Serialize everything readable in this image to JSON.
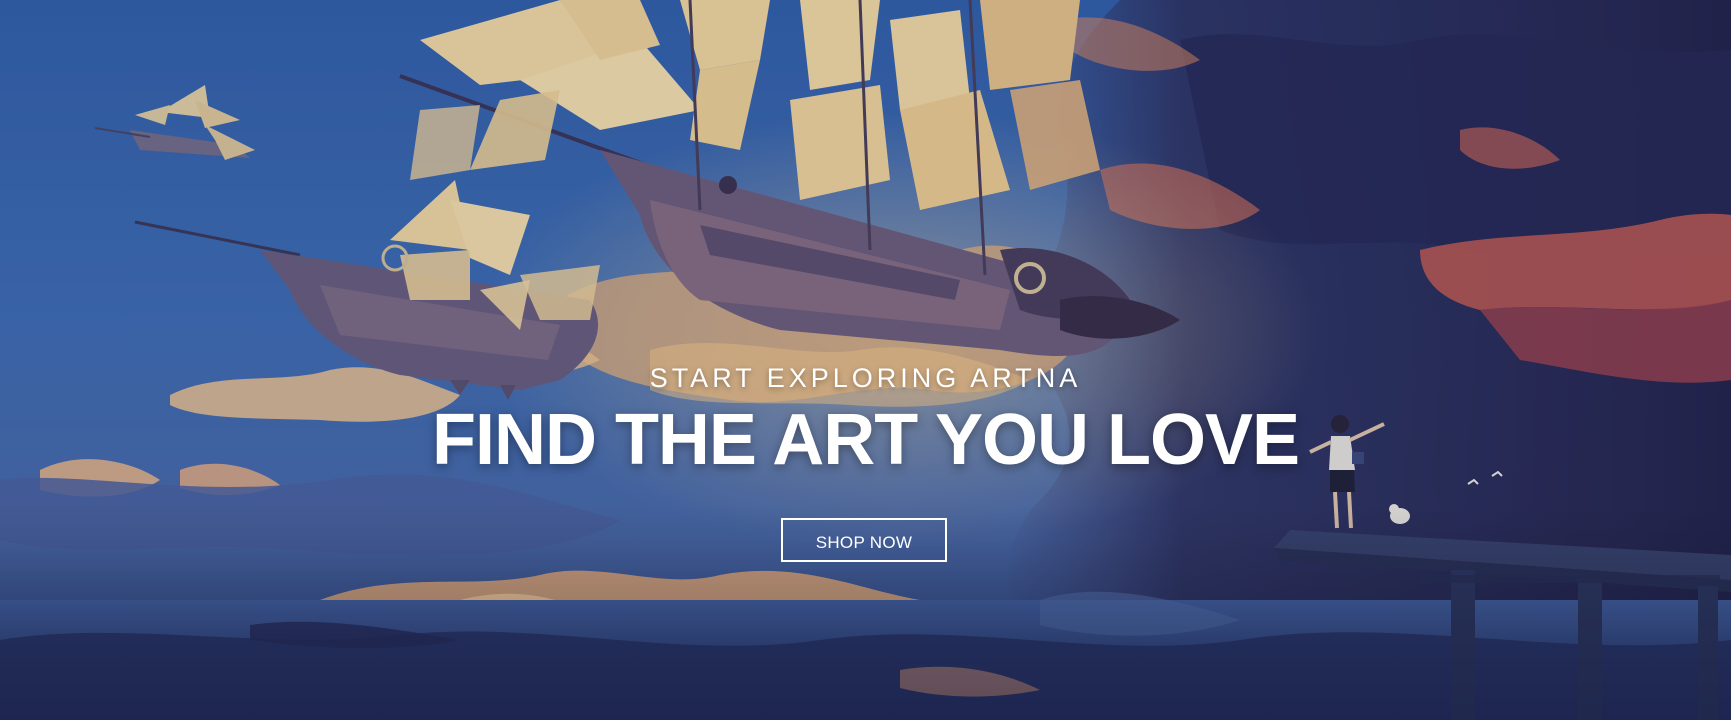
{
  "hero": {
    "eyebrow": "START EXPLORING ARTNA",
    "headline": "FIND THE ART YOU LOVE",
    "cta_label": "SHOP NOW"
  },
  "artwork": {
    "subjects": [
      "sky-airships",
      "cloudscape",
      "child-on-pier"
    ],
    "palette": {
      "sky_blue": "#3a66b0",
      "deep_indigo": "#2b2f5c",
      "sail_cream": "#f3dca0",
      "cloud_orange": "#e9a86a",
      "cloud_red": "#c4564f",
      "text": "#ffffff"
    }
  }
}
